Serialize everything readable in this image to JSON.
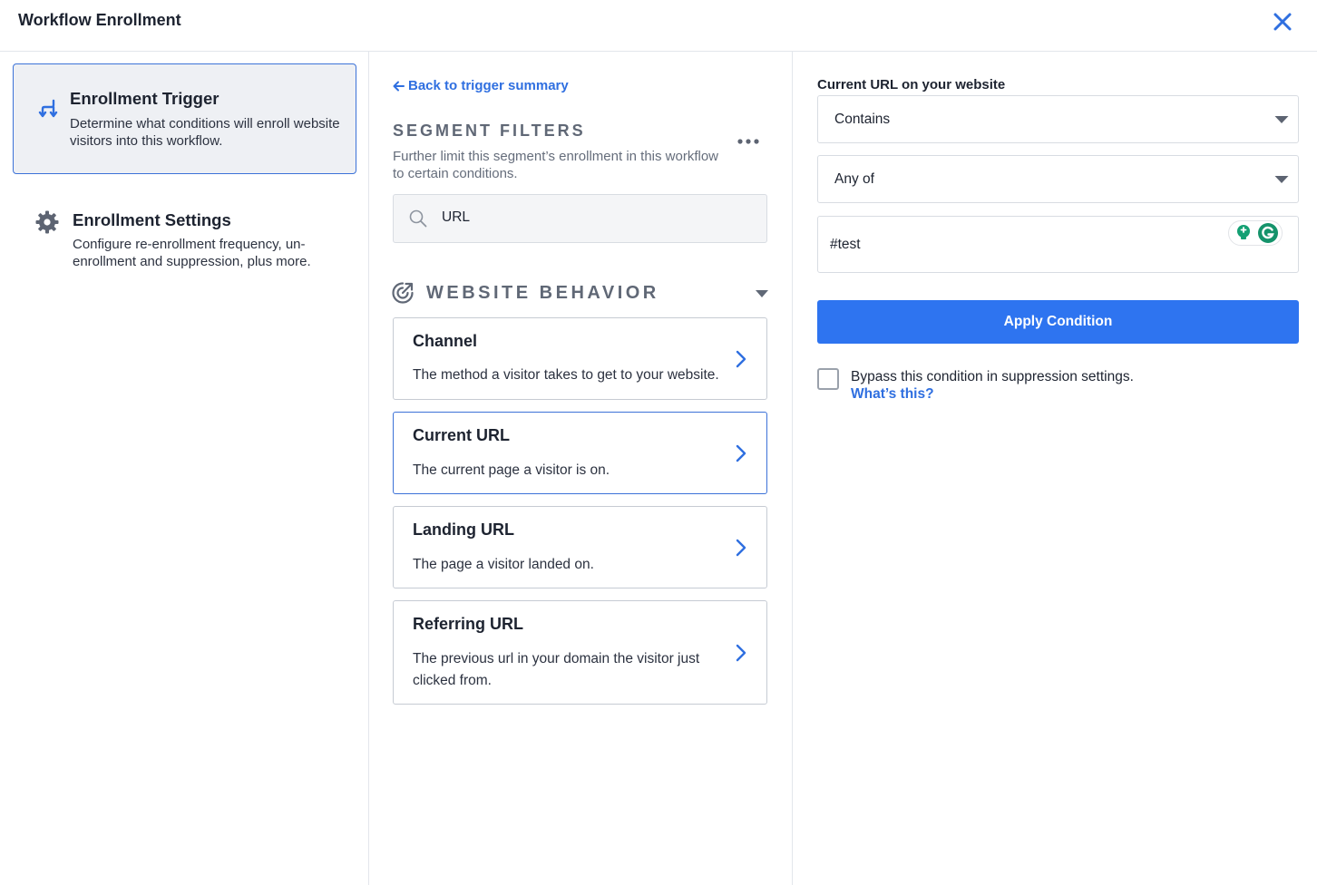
{
  "header": {
    "title": "Workflow Enrollment"
  },
  "sidebar": {
    "items": [
      {
        "title": "Enrollment Trigger",
        "description": "Determine what conditions will enroll website visitors into this workflow.",
        "icon": "branch-arrows-icon",
        "active": true
      },
      {
        "title": "Enrollment Settings",
        "description": "Configure re-enrollment frequency, un-enrollment and suppression, plus more.",
        "icon": "gear-icon",
        "active": false
      }
    ]
  },
  "filters": {
    "back_link": "Back to trigger summary",
    "heading": "SEGMENT FILTERS",
    "description": "Further limit this segment’s enrollment in this workflow to certain conditions.",
    "search_value": "URL",
    "group": {
      "heading": "WEBSITE BEHAVIOR",
      "options": [
        {
          "title": "Channel",
          "description": "The method a visitor takes to get to your website.",
          "selected": false
        },
        {
          "title": "Current URL",
          "description": "The current page a visitor is on.",
          "selected": true
        },
        {
          "title": "Landing URL",
          "description": "The page a visitor landed on.",
          "selected": false
        },
        {
          "title": "Referring URL",
          "description": "The previous url in your domain the visitor just clicked from.",
          "selected": false
        }
      ]
    }
  },
  "condition": {
    "label": "Current URL on your website",
    "operator": "Contains",
    "match_mode": "Any of",
    "value": "#test",
    "apply_label": "Apply Condition",
    "bypass_label": "Bypass this condition in suppression settings.",
    "bypass_checked": false,
    "help_link": "What’s this?"
  },
  "colors": {
    "accent": "#2e74f0",
    "link": "#2f6fe0",
    "active_card_bg": "#eef0f4",
    "active_border": "#3c72d8"
  }
}
